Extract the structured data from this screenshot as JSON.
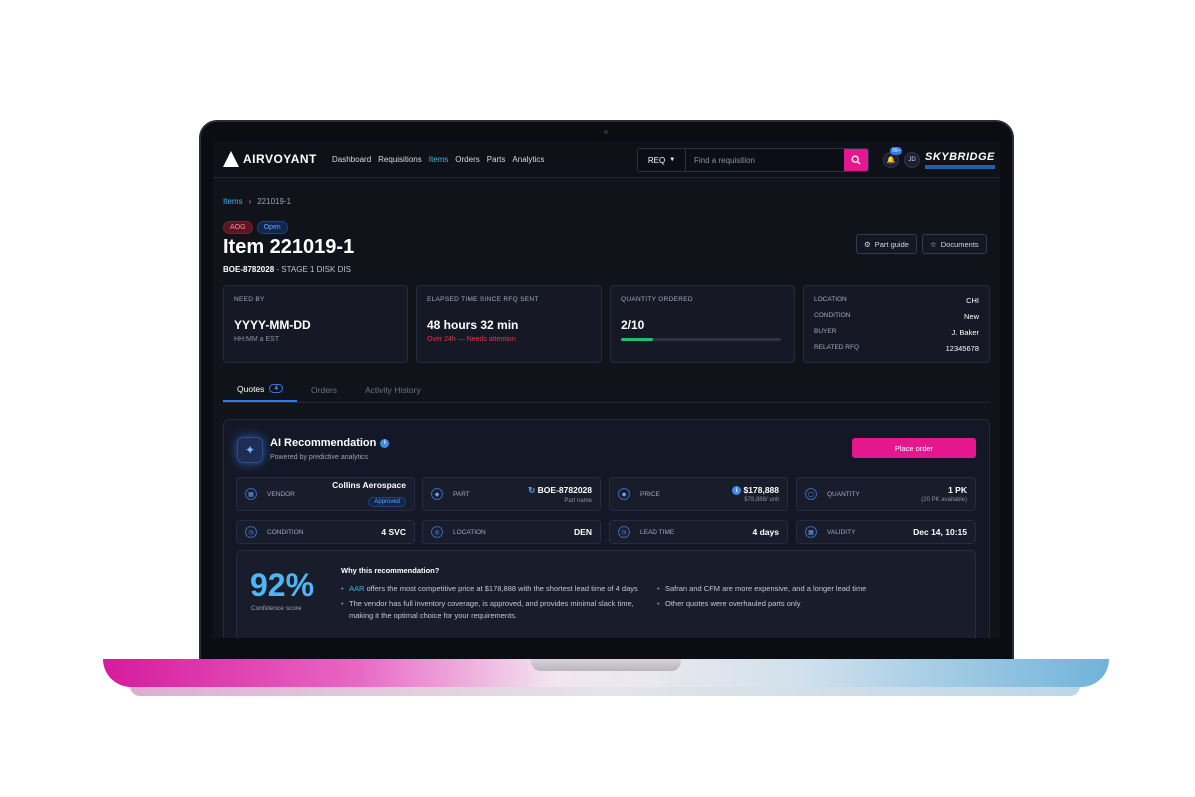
{
  "topbar": {
    "logo_text": "AIRVOYANT",
    "nav": [
      "Dashboard",
      "Requisitions",
      "Items",
      "Orders",
      "Parts",
      "Analytics"
    ],
    "nav_active_index": 2,
    "search_type": "REQ",
    "search_placeholder": "Find a requisition",
    "notification_count": "99+",
    "user_initials": "JD",
    "brand": "SKYBRIDGE"
  },
  "breadcrumb": {
    "parent": "Items",
    "current": "221019-1"
  },
  "badges": {
    "aog": "AOG",
    "status": "Open"
  },
  "item": {
    "title": "Item 221019-1",
    "part_number": "BOE-8782028",
    "description": " - STAGE 1 DISK DIS"
  },
  "header_buttons": {
    "part_guide": "Part guide",
    "documents": "Documents"
  },
  "cards": {
    "need_by": {
      "label": "NEED BY",
      "value": "YYYY-MM-DD",
      "sub": "HH:MM a EST"
    },
    "elapsed": {
      "label": "ELAPSED TIME SINCE RFQ SENT",
      "value": "48 hours 32 min",
      "warning": "Over 24h — Needs attention"
    },
    "quantity": {
      "label": "QUANTITY ORDERED",
      "value": "2/10",
      "progress": 0.2
    },
    "details": [
      {
        "k": "LOCATION",
        "v": "CHI"
      },
      {
        "k": "CONDITION",
        "v": "New"
      },
      {
        "k": "BUYER",
        "v": "J. Baker"
      },
      {
        "k": "RELATED RFQ",
        "v": "12345678"
      }
    ]
  },
  "tabs": [
    {
      "label": "Quotes",
      "count": "4"
    },
    {
      "label": "Orders"
    },
    {
      "label": "Activity History"
    }
  ],
  "recommendation": {
    "title": "AI Recommendation",
    "subtitle": "Powered by predictive analytics",
    "place_order": "Place order",
    "vendor": {
      "label": "VENDOR",
      "value": "Collins Aerospace",
      "status": "Approved"
    },
    "part": {
      "label": "PART",
      "value": "BOE-8782028",
      "sub": "Part name"
    },
    "price": {
      "label": "PRICE",
      "value": "$178,888",
      "sub": "$78,888/ unit"
    },
    "quantity": {
      "label": "QUANTITY",
      "value": "1 PK",
      "sub": "(20 PK available)"
    },
    "condition": {
      "label": "CONDITION",
      "value": "4 SVC"
    },
    "location": {
      "label": "LOCATION",
      "value": "DEN"
    },
    "lead_time": {
      "label": "LEAD TIME",
      "value": "4 days"
    },
    "validity": {
      "label": "VALIDITY",
      "value": "Dec 14, 10:15"
    },
    "confidence": {
      "value": "92%",
      "label": "Confidence score"
    },
    "why_title": "Why this recommendation?",
    "reason_1_vendor": "AAR",
    "reason_1_rest": " offers the most competitive price at $178,888 with the shortest lead time of 4 days",
    "reason_2": "The vendor has full inventory coverage, is approved, and provides minimal slack time, making it the optimal choice for your requirements.",
    "reason_3": "Safran and CFM are more expensive, and a longer lead time",
    "reason_4": "Other quotes were overhauled parts only"
  }
}
